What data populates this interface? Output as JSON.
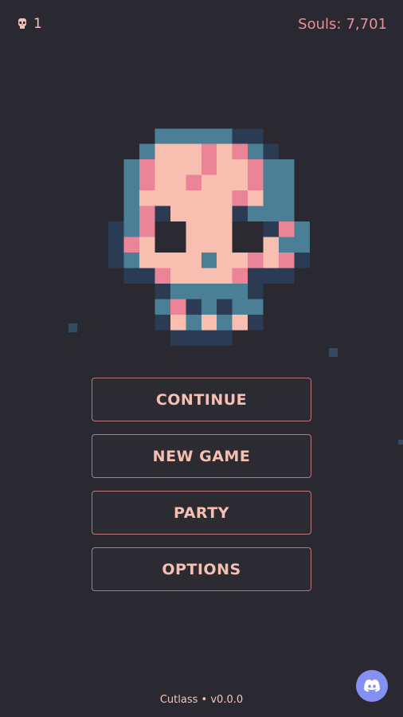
{
  "hud": {
    "lives": "1",
    "souls_label": "Souls:",
    "souls_value": "7,701"
  },
  "mascot": {
    "icon": "pixel-skull-icon"
  },
  "menu": {
    "continue": "CONTINUE",
    "new_game": "NEW GAME",
    "party": "PARTY",
    "options": "OPTIONS"
  },
  "footer": {
    "app_name": "Cutlass",
    "separator": "•",
    "version": "v0.0.0"
  },
  "colors": {
    "background": "#2a2830",
    "skin": "#f8bfb1",
    "blush": "#ec8497",
    "blue": "#4a7f96",
    "navy": "#2b3b54",
    "accent": "#ee8f98",
    "discord": "#8491f3"
  }
}
